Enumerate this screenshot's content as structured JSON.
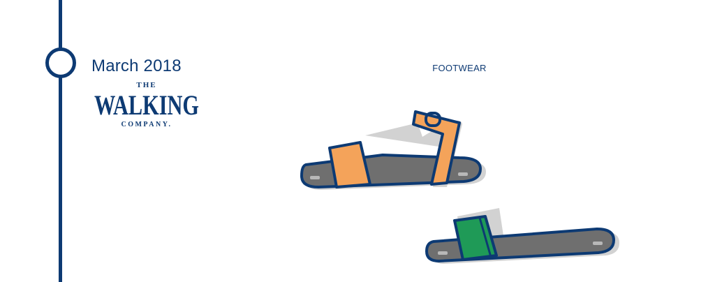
{
  "timeline": {
    "date": "March 2018"
  },
  "brand": {
    "logo_line1": "THE",
    "logo_line2": "WALKING",
    "logo_line3": "COMPANY."
  },
  "section": {
    "category": "FOOTWEAR"
  },
  "colors": {
    "navy": "#0d3a73",
    "orange": "#f4a35a",
    "green": "#1f9a57",
    "sole_gray": "#6f6f6f",
    "shadow_gray": "#c9c9c9"
  },
  "icons": {
    "sandal_1": "ankle-strap-sandal-icon",
    "sandal_2": "slide-sandal-icon"
  }
}
